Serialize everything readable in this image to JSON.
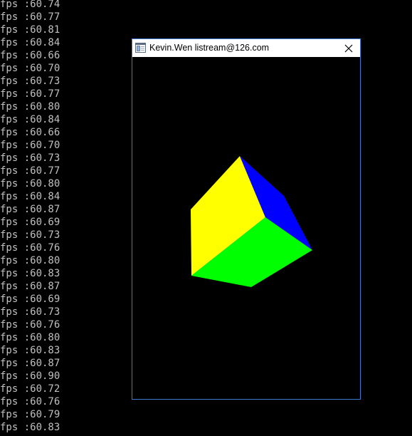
{
  "console": {
    "lines": [
      "fps :60.74",
      "fps :60.77",
      "fps :60.81",
      "fps :60.84",
      "fps :60.66",
      "fps :60.70",
      "fps :60.73",
      "fps :60.77",
      "fps :60.80",
      "fps :60.84",
      "fps :60.66",
      "fps :60.70",
      "fps :60.73",
      "fps :60.77",
      "fps :60.80",
      "fps :60.84",
      "fps :60.87",
      "fps :60.69",
      "fps :60.73",
      "fps :60.76",
      "fps :60.80",
      "fps :60.83",
      "fps :60.87",
      "fps :60.69",
      "fps :60.73",
      "fps :60.76",
      "fps :60.80",
      "fps :60.83",
      "fps :60.87",
      "fps :60.90",
      "fps :60.72",
      "fps :60.76",
      "fps :60.79",
      "fps :60.83"
    ]
  },
  "window": {
    "title": "Kevin.Wen listream@126.com",
    "close_icon": "close-icon",
    "app_icon": "app-window-icon"
  },
  "scene": {
    "cube_face_colors": {
      "top": "#ffff00",
      "right": "#0000ff",
      "front": "#00ff00"
    },
    "background": "#000000"
  }
}
